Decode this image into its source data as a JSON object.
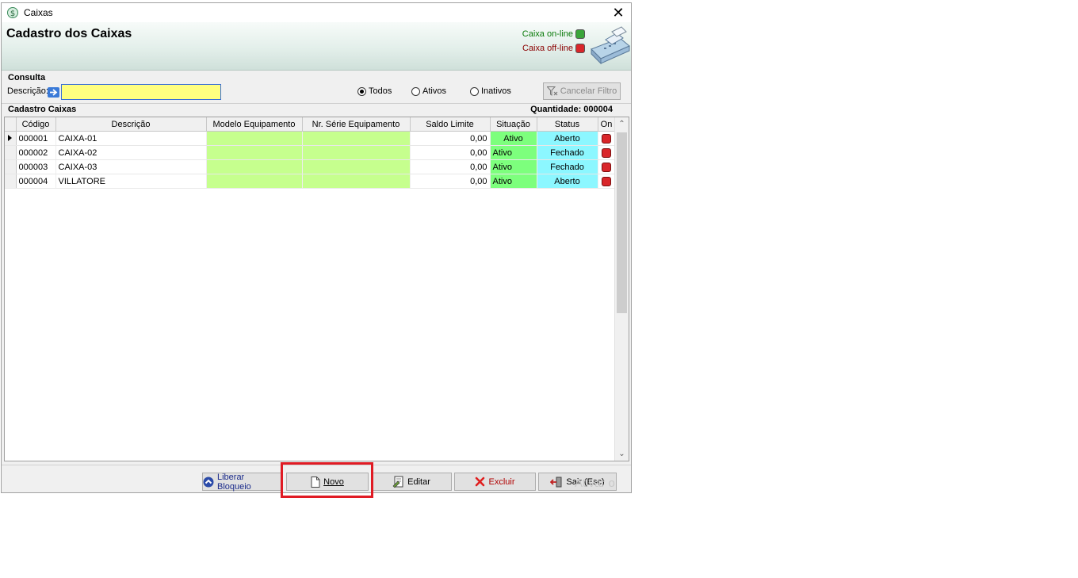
{
  "window": {
    "title": "Caixas",
    "close_glyph": "✕"
  },
  "header": {
    "title": "Cadastro dos Caixas",
    "legend_online": "Caixa on-line",
    "legend_offline": "Caixa off-line",
    "online_color": "#3aa53a",
    "offline_color": "#d9262a",
    "icon": "cash-register-icon"
  },
  "consulta": {
    "title": "Consulta",
    "desc_label": "Descrição:",
    "desc_value": "",
    "radios": [
      {
        "label": "Todos",
        "selected": true
      },
      {
        "label": "Ativos",
        "selected": false
      },
      {
        "label": "Inativos",
        "selected": false
      }
    ],
    "cancel_filter": "Cancelar Filtro"
  },
  "grid": {
    "title": "Cadastro Caixas",
    "quantity": "Quantidade: 000004",
    "columns": [
      "Código",
      "Descrição",
      "Modelo Equipamento",
      "Nr. Série Equipamento",
      "Saldo Limite",
      "Situação",
      "Status",
      "On"
    ],
    "rows": [
      {
        "codigo": "000001",
        "descricao": "CAIXA-01",
        "modelo": "",
        "serie": "",
        "saldo": "0,00",
        "situacao": "Ativo",
        "status": "Aberto",
        "selected": true
      },
      {
        "codigo": "000002",
        "descricao": "CAIXA-02",
        "modelo": "",
        "serie": "",
        "saldo": "0,00",
        "situacao": "Ativo",
        "status": "Fechado",
        "selected": false
      },
      {
        "codigo": "000003",
        "descricao": "CAIXA-03",
        "modelo": "",
        "serie": "",
        "saldo": "0,00",
        "situacao": "Ativo",
        "status": "Fechado",
        "selected": false
      },
      {
        "codigo": "000004",
        "descricao": "VILLATORE",
        "modelo": "",
        "serie": "",
        "saldo": "0,00",
        "situacao": "Ativo",
        "status": "Aberto",
        "selected": false
      }
    ]
  },
  "footer": {
    "liberar": "Liberar Bloqueio",
    "novo": "Novo",
    "editar": "Editar",
    "excluir": "Excluir",
    "sair": "Sair (Esc)",
    "watermark": "Ativar o"
  },
  "colors": {
    "input_bg": "#ffff80",
    "green_cell": "#c6ff8e",
    "situacao": "#7dff7d",
    "status": "#8cf7ff",
    "highlight": "#e01b24"
  }
}
